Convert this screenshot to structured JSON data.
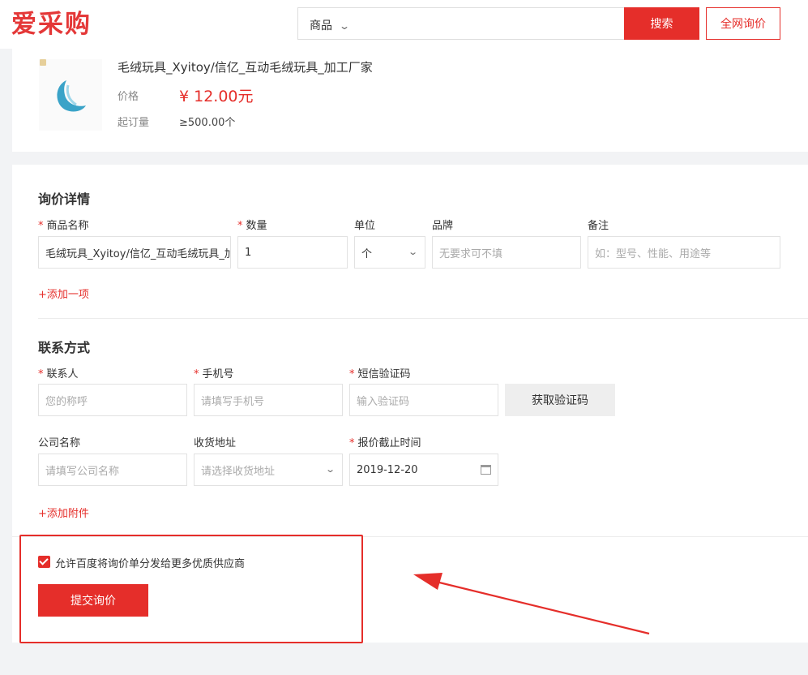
{
  "header": {
    "logo": "爱采购",
    "search_category": "商品",
    "search_placeholder": "",
    "search_button": "搜索",
    "all_inquiry_button": "全网询价"
  },
  "product": {
    "title": "毛绒玩具_Xyitoy/信亿_互动毛绒玩具_加工厂家",
    "price_label": "价格",
    "price": "¥ 12.00元",
    "moq_label": "起订量",
    "moq": "≥500.00个"
  },
  "inquiry": {
    "section_title": "询价详情",
    "labels": {
      "product_name": "商品名称",
      "quantity": "数量",
      "unit": "单位",
      "brand": "品牌",
      "remark": "备注"
    },
    "values": {
      "product_name": "毛绒玩具_Xyitoy/信亿_互动毛绒玩具_加工厂家",
      "quantity": "1",
      "unit": "个"
    },
    "placeholders": {
      "brand": "无要求可不填",
      "remark": "如：型号、性能、用途等"
    },
    "add_item": "+添加一项"
  },
  "contact": {
    "section_title": "联系方式",
    "labels": {
      "contact_person": "联系人",
      "phone": "手机号",
      "sms_code": "短信验证码",
      "company": "公司名称",
      "address": "收货地址",
      "deadline": "报价截止时间"
    },
    "placeholders": {
      "contact_person": "您的称呼",
      "phone": "请填写手机号",
      "sms_code": "输入验证码",
      "company": "请填写公司名称",
      "address": "请选择收货地址"
    },
    "values": {
      "deadline": "2019-12-20"
    },
    "get_code_button": "获取验证码",
    "add_attachment": "+添加附件"
  },
  "footer": {
    "allow_distribute": "允许百度将询价单分发给更多优质供应商",
    "allow_checked": true,
    "submit_button": "提交询价"
  },
  "colors": {
    "brand_red": "#e52e2a",
    "annotation_red": "#e52e2a"
  }
}
